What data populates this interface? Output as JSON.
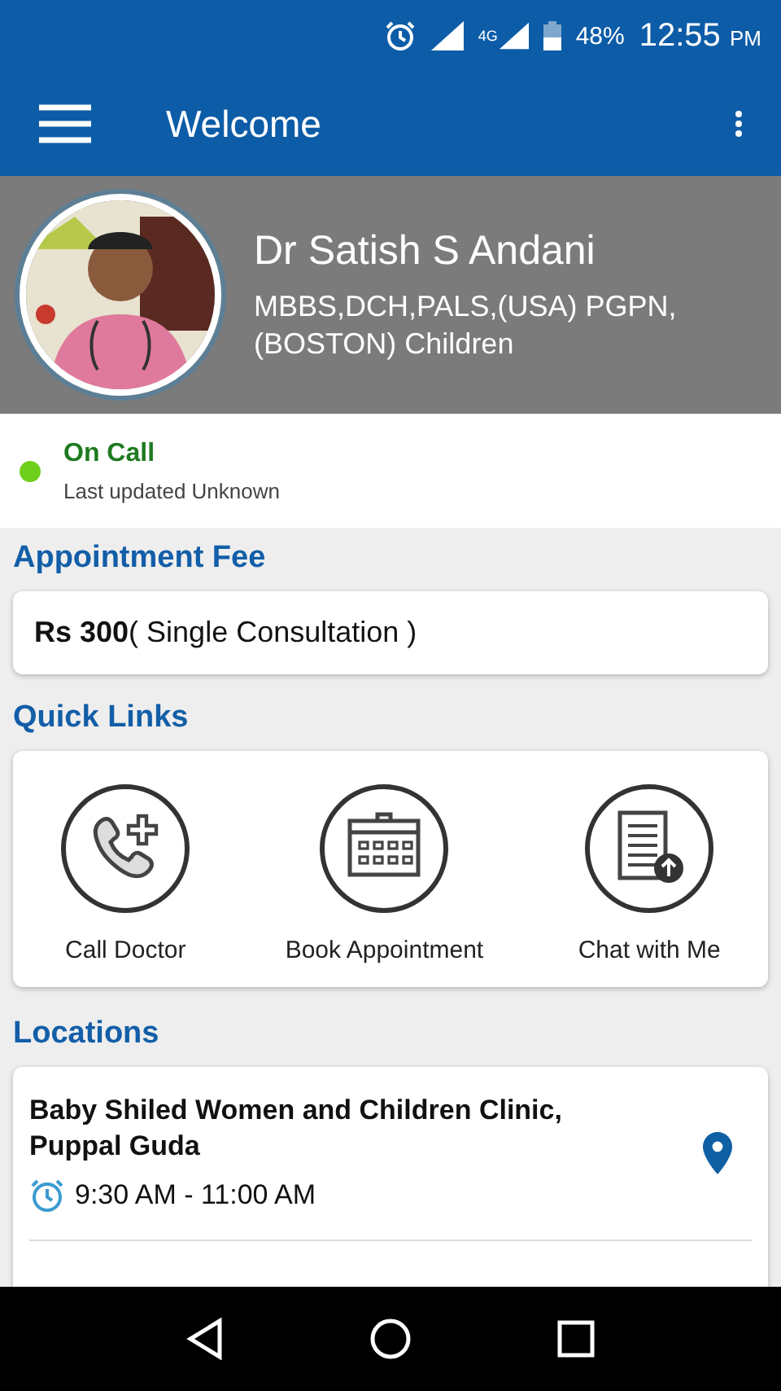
{
  "status_bar": {
    "network": "4G",
    "battery": "48%",
    "time": "12:55",
    "meridiem": "PM"
  },
  "app_bar": {
    "title": "Welcome"
  },
  "profile": {
    "name": "Dr Satish S Andani",
    "qualifications": "MBBS,DCH,PALS,(USA) PGPN, (BOSTON) Children"
  },
  "availability": {
    "label": "On Call",
    "available": true,
    "updated": "Last updated Unknown"
  },
  "appointment_fee": {
    "heading": "Appointment Fee",
    "text": "**Rs 300**( Single Consultation )"
  },
  "quick_links": {
    "heading": "Quick Links",
    "items": [
      {
        "kind": "call",
        "label": "Call Doctor"
      },
      {
        "kind": "book",
        "label": "Book Appointment"
      },
      {
        "kind": "chat",
        "label": "Chat with Me"
      }
    ]
  },
  "locations": {
    "heading": "Locations",
    "items": [
      {
        "name": "Baby Shiled Women and Children Clinic, Puppal Guda",
        "hours": "9:30 AM - 11:00 AM"
      }
    ]
  }
}
